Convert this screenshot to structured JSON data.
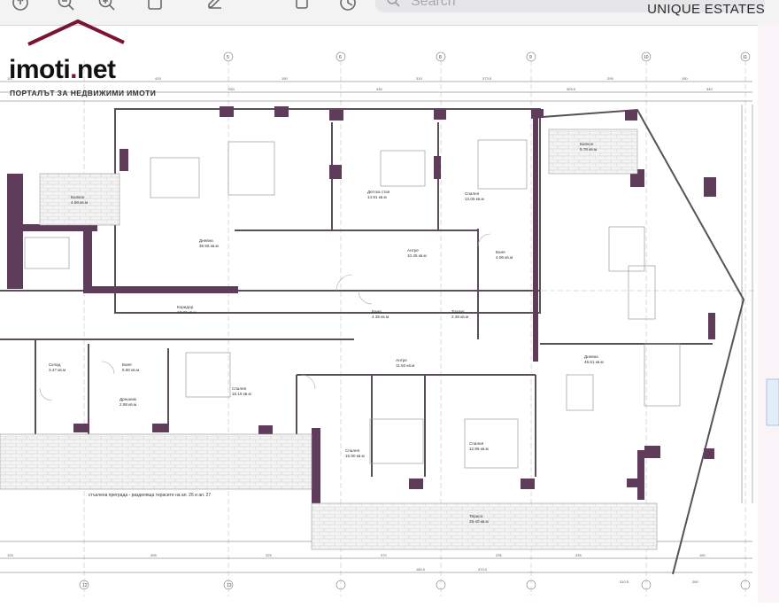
{
  "toolbar": {
    "search_placeholder": "Search",
    "brand": "UNIQUE ESTATES",
    "icons": [
      "share-icon",
      "zoom-out-icon",
      "zoom-in-icon",
      "crop-icon",
      "markup-icon",
      "copy-icon",
      "rotate-icon"
    ]
  },
  "logo": {
    "word_main": "imoti",
    "word_dot": ".",
    "word_tail": "net",
    "tagline": "ПОРТАЛЪТ ЗА НЕДВИЖИМИ ИМОТИ",
    "accent": "#7a1530"
  },
  "plan": {
    "rooms": [
      {
        "name": "Балкон",
        "area": "4.58 кв.м"
      },
      {
        "name": "Дневна",
        "area": "36.56 кв.м"
      },
      {
        "name": "Детска стая",
        "area": "14.81 кв.м"
      },
      {
        "name": "Спалня",
        "area": "12.05 кв.м"
      },
      {
        "name": "Балкон",
        "area": "5.78 кв.м"
      },
      {
        "name": "Баня",
        "area": "4.06 кв.м"
      },
      {
        "name": "Антре",
        "area": "10.45 кв.м"
      },
      {
        "name": "Коридор",
        "area": "17.73 кв.м"
      },
      {
        "name": "Баня",
        "area": "4.39 кв.м"
      },
      {
        "name": "Тоалет",
        "area": "2.36 кв.м"
      },
      {
        "name": "Склад",
        "area": "3.47 кв.м"
      },
      {
        "name": "Баня",
        "area": "5.60 кв.м"
      },
      {
        "name": "Дрешник",
        "area": "2.98 кв.м"
      },
      {
        "name": "Спалня",
        "area": "16.16 кв.м"
      },
      {
        "name": "Антре",
        "area": "11.50 кв.м"
      },
      {
        "name": "Дневна",
        "area": "46.51 кв.м"
      },
      {
        "name": "Спалня",
        "area": "15.90 кв.м"
      },
      {
        "name": "Спалня",
        "area": "12.86 кв.м"
      },
      {
        "name": "Тераса",
        "area": "29.40 кв.м"
      }
    ],
    "note": "стъклена преграда - разделяща терасите на ап. 26 и ап. 27",
    "axes": [
      "5",
      "6",
      "8",
      "9",
      "10",
      "11",
      "12",
      "13"
    ],
    "dims_top": [
      "110",
      "415",
      "150",
      "430",
      "250",
      "310",
      "295",
      "150",
      "373.5",
      "309.5",
      "340"
    ],
    "dims_bottom": [
      "125",
      "495",
      "225",
      "370",
      "180.0",
      "470.0",
      "236",
      "335",
      "310.5",
      "280",
      "160"
    ]
  }
}
